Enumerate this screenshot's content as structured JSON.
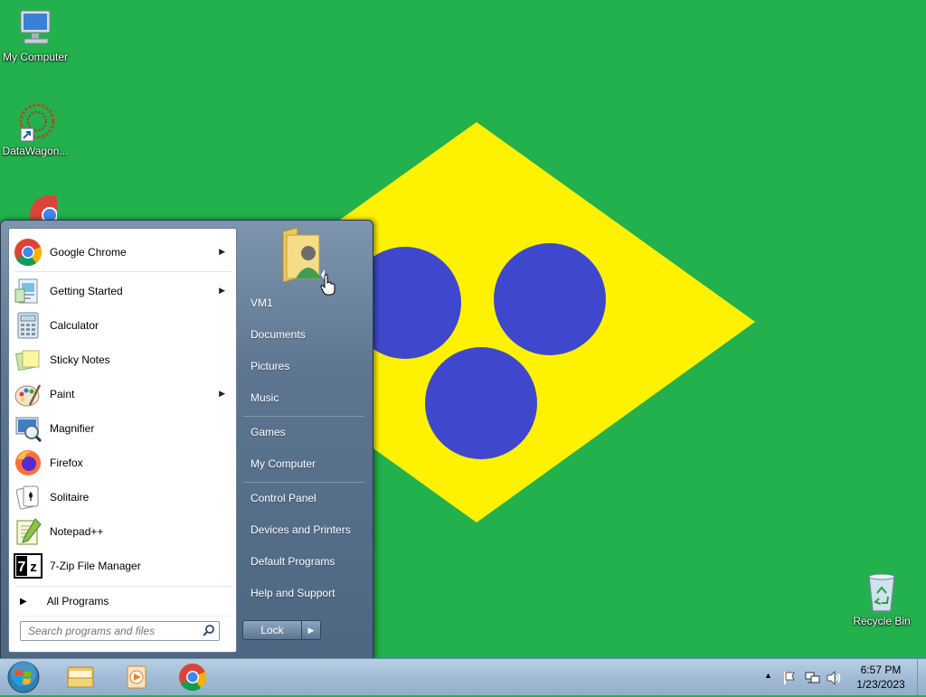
{
  "desktop": {
    "icons": [
      {
        "label": "My Computer",
        "icon": "computer-icon"
      },
      {
        "label": "DataWagon...",
        "icon": "datawagon-shortcut-icon"
      },
      {
        "label": "",
        "icon": "chrome-icon"
      },
      {
        "label": "Recycle Bin",
        "icon": "recycle-bin-icon"
      }
    ],
    "wallpaper_colors": {
      "background": "#22b14c",
      "diamond": "#fff200",
      "circles": "#3f48cc"
    }
  },
  "start_menu": {
    "programs": [
      {
        "label": "Google Chrome",
        "icon": "chrome-icon",
        "has_submenu": true
      },
      {
        "label": "Getting Started",
        "icon": "getting-started-icon",
        "has_submenu": true
      },
      {
        "label": "Calculator",
        "icon": "calculator-icon",
        "has_submenu": false
      },
      {
        "label": "Sticky Notes",
        "icon": "sticky-notes-icon",
        "has_submenu": false
      },
      {
        "label": "Paint",
        "icon": "paint-icon",
        "has_submenu": true
      },
      {
        "label": "Magnifier",
        "icon": "magnifier-icon",
        "has_submenu": false
      },
      {
        "label": "Firefox",
        "icon": "firefox-icon",
        "has_submenu": false
      },
      {
        "label": "Solitaire",
        "icon": "solitaire-icon",
        "has_submenu": false
      },
      {
        "label": "Notepad++",
        "icon": "notepadpp-icon",
        "has_submenu": false
      },
      {
        "label": "7-Zip File Manager",
        "icon": "7zip-icon",
        "has_submenu": false
      }
    ],
    "all_programs": "All Programs",
    "search_placeholder": "Search programs and files",
    "right_links": [
      "VM1",
      "Documents",
      "Pictures",
      "Music",
      "Games",
      "My Computer",
      "Control Panel",
      "Devices and Printers",
      "Default Programs",
      "Help and Support"
    ],
    "shutdown_label": "Lock"
  },
  "taskbar": {
    "pinned": [
      "windows-explorer-icon",
      "media-player-icon",
      "chrome-icon"
    ],
    "clock_time": "6:57 PM",
    "clock_date": "1/23/2023"
  }
}
